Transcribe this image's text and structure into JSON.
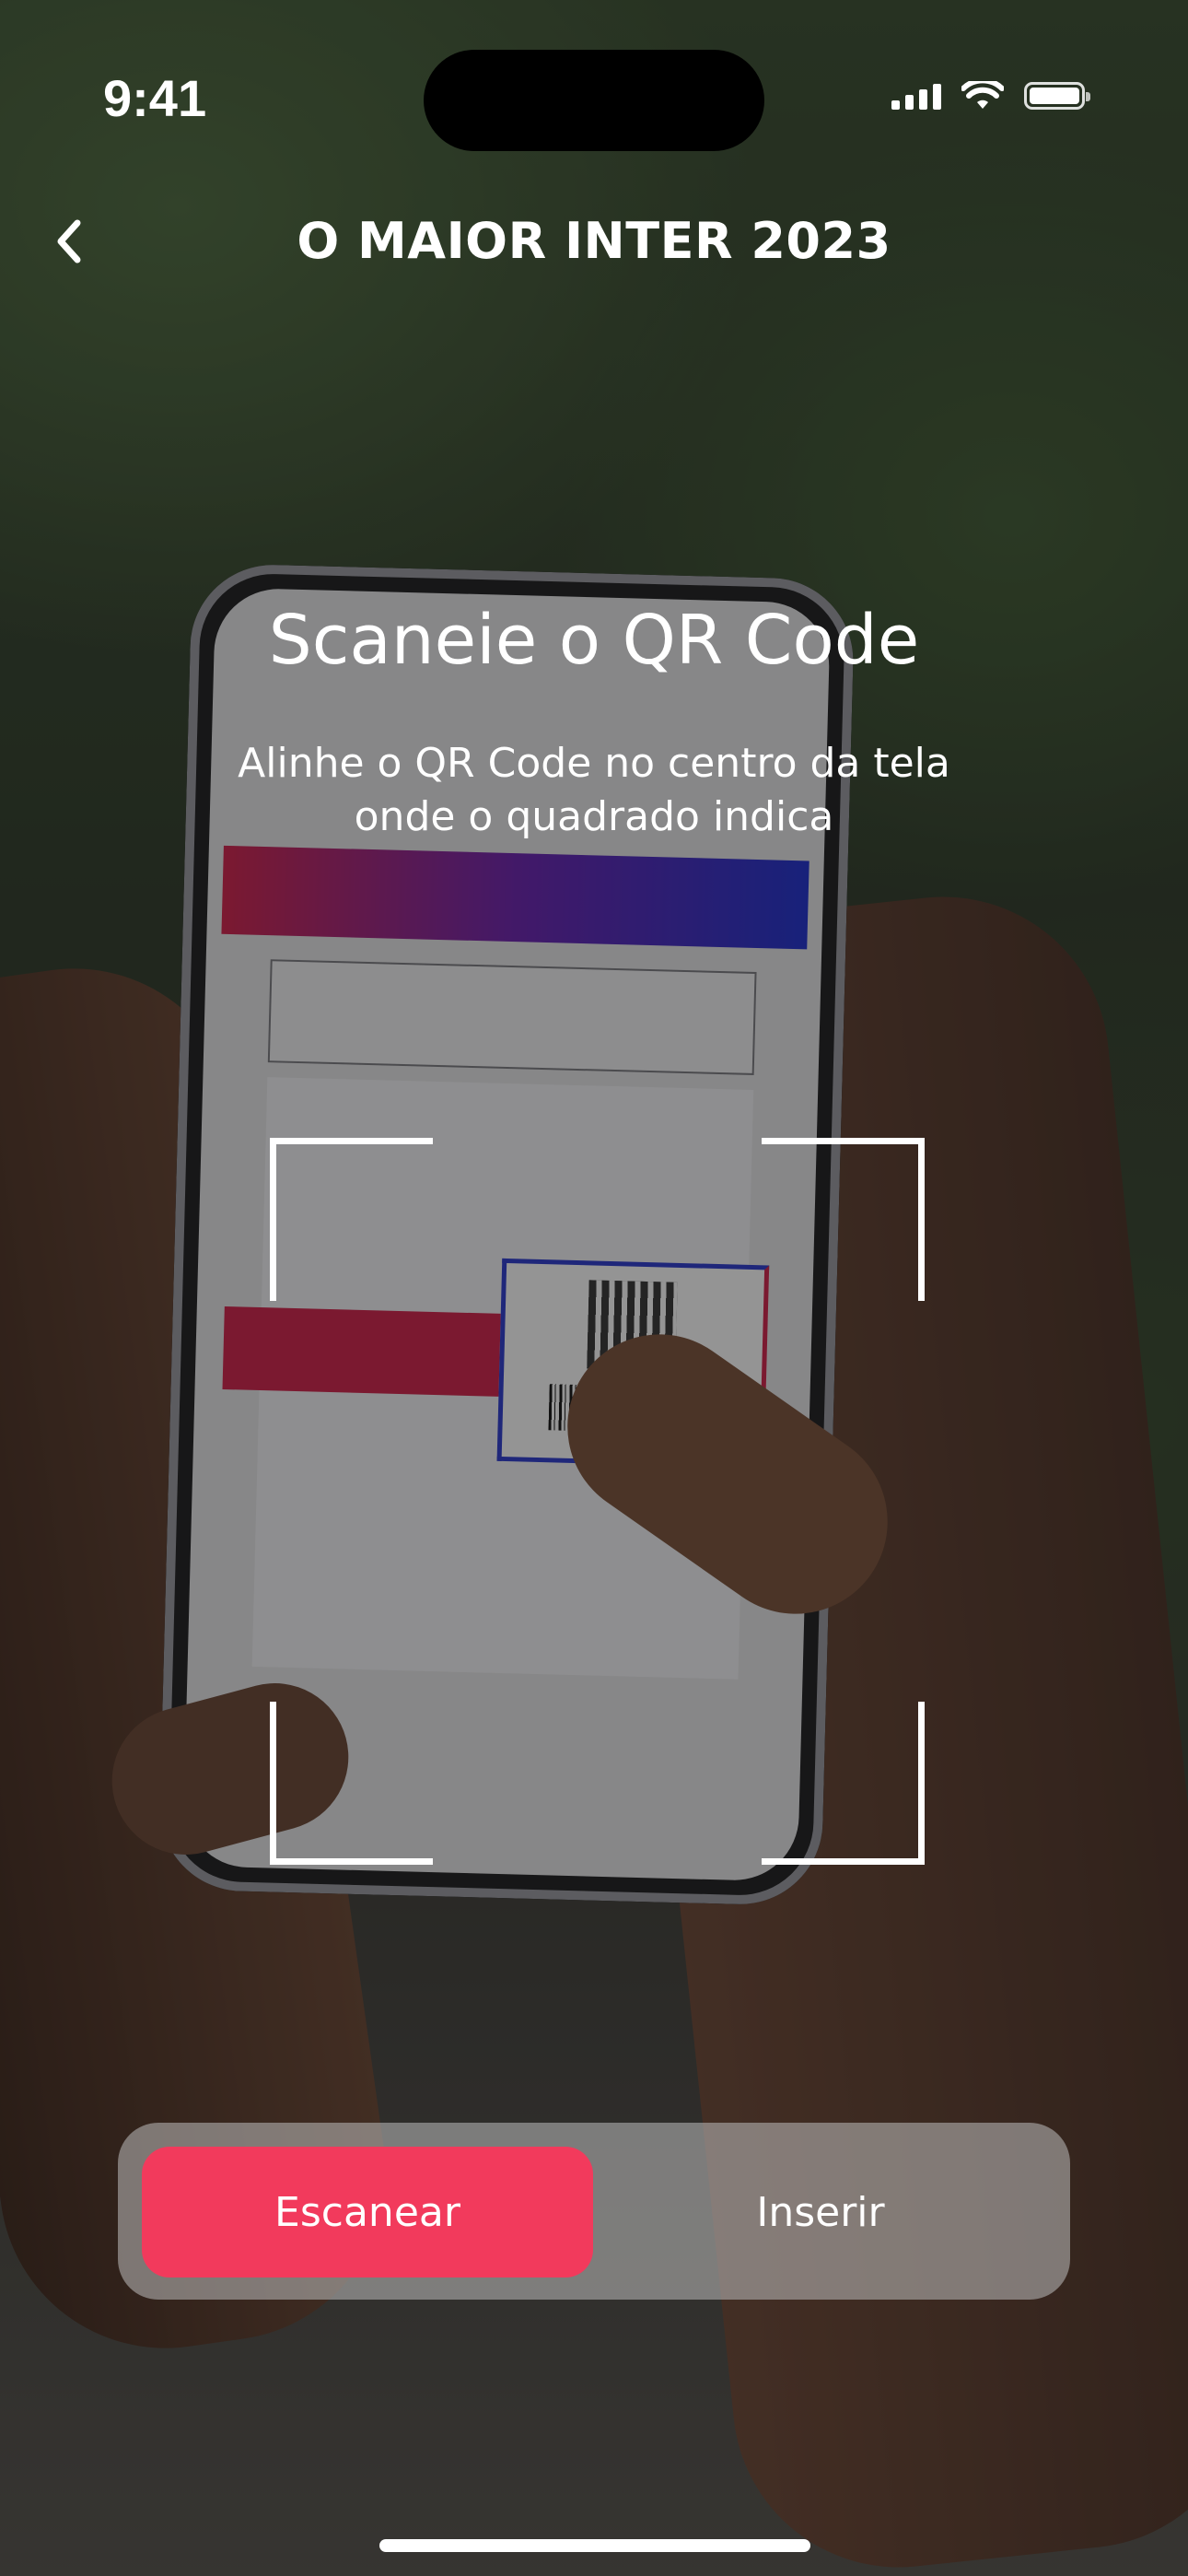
{
  "status_bar": {
    "time": "9:41",
    "icons": [
      "signal-icon",
      "wifi-icon",
      "battery-icon"
    ]
  },
  "header": {
    "title": "O MAIOR INTER 2023",
    "back_icon": "chevron-left-icon"
  },
  "scanner": {
    "title": "Scaneie o QR Code",
    "subtitle": "Alinhe o QR Code no centro da tela onde o quadrado indica"
  },
  "mode_switch": {
    "selected": "Escanear",
    "options": [
      "Escanear",
      "Inserir"
    ]
  },
  "colors": {
    "accent": "#f23a5c",
    "overlay": "#121212",
    "text": "#ffffff"
  }
}
